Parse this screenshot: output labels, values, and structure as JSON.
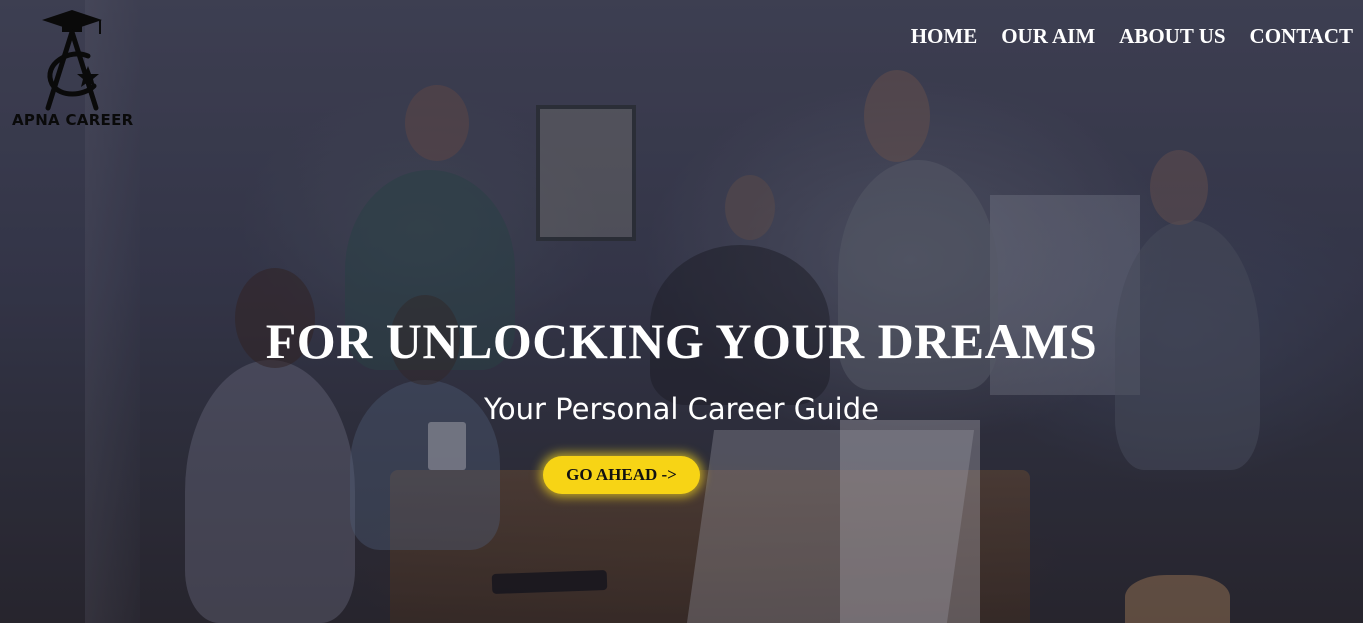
{
  "brand": {
    "name": "APNA CAREER",
    "logo_icon": "graduation-cap-compass-star-icon"
  },
  "nav": {
    "items": [
      {
        "label": "HOME"
      },
      {
        "label": "OUR AIM"
      },
      {
        "label": "ABOUT US"
      },
      {
        "label": "CONTACT"
      }
    ]
  },
  "hero": {
    "headline": "FOR UNLOCKING YOUR DREAMS",
    "subheadline": "Your Personal Career Guide",
    "cta_label": "GO AHEAD ->",
    "background_image": "team-meeting-photo"
  },
  "colors": {
    "cta_bg": "#f7d415",
    "nav_text": "#ffffff",
    "logo": "#0a0a0a"
  }
}
